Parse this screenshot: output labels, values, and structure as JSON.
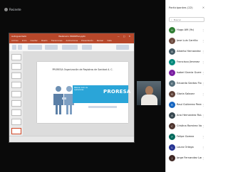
{
  "meeting": {
    "title": "Reúnete"
  },
  "ppt": {
    "title_left": "Autoguardado",
    "title_center": "Webinario PRORESA.pptx",
    "title_right": "— □ ✕",
    "menu": [
      "Archivo",
      "Inicio",
      "Insertar",
      "Diseño",
      "Transiciones",
      "Animaciones",
      "Presentación",
      "Revisar",
      "Vista"
    ],
    "slide": {
      "title": "PRORESA Organización de Registros de Sanidad A. C.",
      "subtitle": "Webinar Inicio de operaciones",
      "logo": "PRORESA"
    }
  },
  "panel": {
    "title": "Participantes (22)",
    "search_placeholder": "Buscar",
    "participants": [
      {
        "name": "Hugo AM (Yo)",
        "color": "#2e7d32",
        "initial": "H"
      },
      {
        "name": "Jose Luis Carrillo",
        "color": "#6d4c41",
        "initial": "J"
      },
      {
        "name": "Alberto Hernandez",
        "color": "#455a64",
        "initial": "A"
      },
      {
        "name": "Francisco Jimenez",
        "color": "#00897b",
        "initial": "F"
      },
      {
        "name": "Isabel Garcia Guerra",
        "color": "#7b1fa2",
        "initial": "I"
      },
      {
        "name": "Eduardo Santos Flores",
        "color": "#546e7a",
        "initial": "E"
      },
      {
        "name": "Gloria Salazar",
        "color": "#5d4037",
        "initial": "G"
      },
      {
        "name": "Raul Gutierrez Perez",
        "color": "#1565c0",
        "initial": "R"
      },
      {
        "name": "Ana Hernandez Ruiz",
        "color": "#37474f",
        "initial": "A"
      },
      {
        "name": "Cristina Ramirez Valle",
        "color": "#4e342e",
        "initial": "C"
      },
      {
        "name": "Felipe Gomez",
        "color": "#00695c",
        "initial": "F"
      },
      {
        "name": "Laura Ortega",
        "color": "#283593",
        "initial": "L"
      },
      {
        "name": "Jorge Fernandez Lara",
        "color": "#3e2723",
        "initial": "J"
      }
    ]
  }
}
